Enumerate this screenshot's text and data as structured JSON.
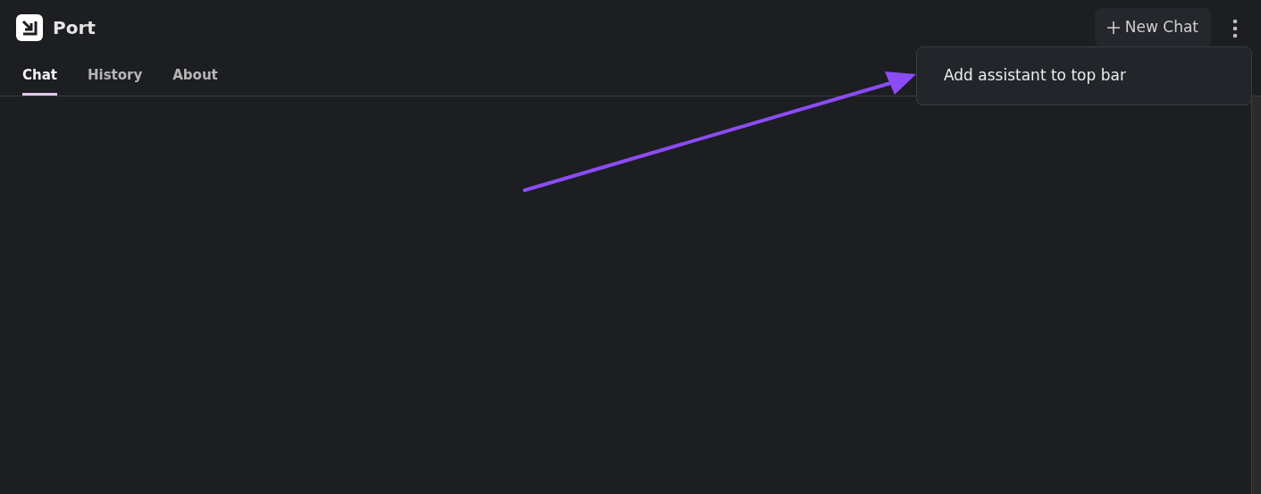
{
  "app": {
    "title": "Port"
  },
  "tabs": [
    {
      "label": "Chat",
      "selected": true
    },
    {
      "label": "History",
      "selected": false
    },
    {
      "label": "About",
      "selected": false
    }
  ],
  "new_chat_button": {
    "label": "New Chat"
  },
  "menu": {
    "open": true,
    "items": [
      {
        "label": "Add assistant to top bar"
      }
    ]
  }
}
